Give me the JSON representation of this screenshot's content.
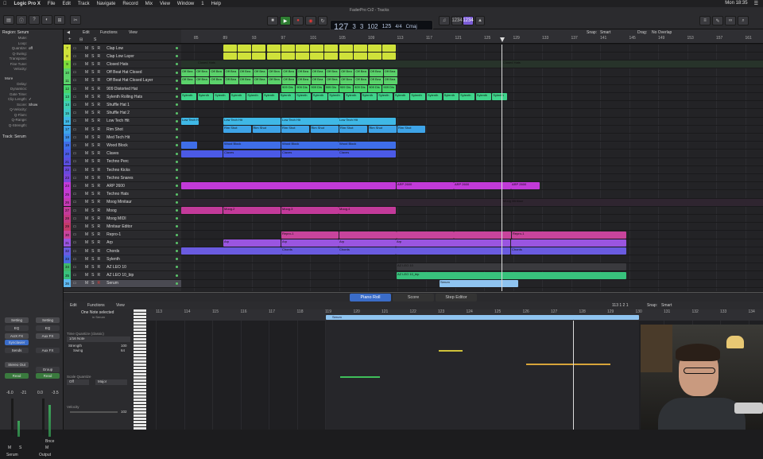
{
  "menubar": {
    "app": "Logic Pro X",
    "items": [
      "File",
      "Edit",
      "Track",
      "Navigate",
      "Record",
      "Mix",
      "View",
      "Window",
      "1",
      "Help"
    ],
    "time": "Mon 18:35"
  },
  "window_title": "FaderPro Cr2 - Tracks",
  "lcd": {
    "bar": "127",
    "beat": "3",
    "div": "3",
    "tick": "102",
    "tempo": "125",
    "timesig": "4/4",
    "key": "Cmaj",
    "bar_label": "BAR",
    "beat_label": "BEAT",
    "div_label": "DIV",
    "tick_label": "TICK",
    "tempo_label": "TEMPO",
    "sig_label": "KEY"
  },
  "toolbar": {
    "snap_label": "Snap:",
    "snap_value": "Smart",
    "drag_label": "Drag:",
    "drag_value": "No Overlap",
    "cpu_badge": "1234"
  },
  "inspector": {
    "region_label": "Region: Serum",
    "rows": [
      [
        "Mute:",
        ""
      ],
      [
        "Loop:",
        ""
      ],
      [
        "Quantize:",
        "off"
      ],
      [
        "Q-Swing:",
        ""
      ],
      [
        "Transpose:",
        ""
      ],
      [
        "Fine Tune:",
        ""
      ],
      [
        "Velocity:",
        ""
      ]
    ],
    "more": "More",
    "rows2": [
      [
        "Delay:",
        ""
      ],
      [
        "Dynamics:",
        ""
      ],
      [
        "Gate Time:",
        ""
      ],
      [
        "Clip Length:",
        "✓"
      ],
      [
        "Score:",
        "Show"
      ],
      [
        "Q-Velocity:",
        ""
      ],
      [
        "Q-Flam:",
        ""
      ],
      [
        "Q-Range:",
        ""
      ],
      [
        "Q-Strength:",
        ""
      ]
    ],
    "track_label": "Track: Serum",
    "strip1": {
      "setting": "Setting",
      "eq": "EQ",
      "fx": "AUX FX",
      "sidechain": "Synclavier",
      "sends": "Sends",
      "stereo": "Stereo Out",
      "mode": "Read",
      "vol": "-6.0",
      "pan": "-21",
      "name": "Serum"
    },
    "strip2": {
      "setting": "Setting",
      "eq": "EQ",
      "fx": "Aux FX",
      "sends": "Aux FX",
      "group": "Group",
      "mode": "Read",
      "vol": "0.0",
      "pan": "-3.5",
      "bnce": "Bnce",
      "name": "Output"
    }
  },
  "tracklist": {
    "edit": "Edit",
    "functions": "Functions",
    "view": "View",
    "tracks": [
      {
        "n": "7",
        "name": "Clap Low",
        "c": "#cfe13a"
      },
      {
        "n": "8",
        "name": "Clap Low Layer",
        "c": "#cfe13a"
      },
      {
        "n": "9",
        "name": "Closed Hats",
        "c": "#7ddc3a"
      },
      {
        "n": "10",
        "name": "Off Beat Hat Closed",
        "c": "#5bd26b"
      },
      {
        "n": "11",
        "name": "Off Beat Hat Closed Layer",
        "c": "#5bd26b"
      },
      {
        "n": "12",
        "name": "909 Distorted Hat",
        "c": "#48d46a"
      },
      {
        "n": "13",
        "name": "Sylenth Rolling Hats",
        "c": "#3fd48b"
      },
      {
        "n": "14",
        "name": "Shuffle Hat 1",
        "c": "#3fcfb1"
      },
      {
        "n": "15",
        "name": "Shuffle Hat 2",
        "c": "#3fc7c7"
      },
      {
        "n": "16",
        "name": "Low Tech Hit",
        "c": "#3fb8e6"
      },
      {
        "n": "17",
        "name": "Rim Shot",
        "c": "#3ea4e8"
      },
      {
        "n": "18",
        "name": "Med Tech Hit",
        "c": "#3c8fe8"
      },
      {
        "n": "19",
        "name": "Wood Block",
        "c": "#3f6ee8"
      },
      {
        "n": "20",
        "name": "Claves",
        "c": "#4b5ae6"
      },
      {
        "n": "21",
        "name": "Techno Perc",
        "c": "#5a4fe0"
      },
      {
        "n": "22",
        "name": "Techno Kicks",
        "c": "#6a49dc"
      },
      {
        "n": "23",
        "name": "Techno Snares",
        "c": "#7a45d8"
      },
      {
        "n": "24",
        "name": "ARP 2600",
        "c": "#c13ad8"
      },
      {
        "n": "25",
        "name": "Techno Hats",
        "c": "#c33ad0"
      },
      {
        "n": "26",
        "name": "Moog Minitaur",
        "c": "#c33ab4"
      },
      {
        "n": "27",
        "name": "Moog",
        "c": "#c33a9a"
      },
      {
        "n": "28",
        "name": "Moog MIDI",
        "c": "#c33a82"
      },
      {
        "n": "29",
        "name": "Minitaur Editor",
        "c": "#c33a6a"
      },
      {
        "n": "30",
        "name": "Repro-1",
        "c": "#c8449c"
      },
      {
        "n": "31",
        "name": "Arp",
        "c": "#9a55e0"
      },
      {
        "n": "32",
        "name": "Chords",
        "c": "#6a5be0"
      },
      {
        "n": "33",
        "name": "Sylenth",
        "c": "#4a68e0"
      },
      {
        "n": "34",
        "name": "AZ LEO 10",
        "c": "#3fb86a"
      },
      {
        "n": "35",
        "name": "AZ LEO 10_bip",
        "c": "#38c27c"
      },
      {
        "n": "36",
        "name": "Serum",
        "c": "#5fb8f0"
      }
    ]
  },
  "ruler": {
    "bars": [
      "85",
      "89",
      "93",
      "97",
      "101",
      "105",
      "109",
      "113",
      "117",
      "121",
      "125",
      "129",
      "133",
      "137",
      "141",
      "145",
      "149",
      "153",
      "157",
      "161"
    ]
  },
  "regions": [
    {
      "lane": 0,
      "labels": [
        "Clap Lo",
        "Clap Lo",
        "Clap Lo",
        "Clap Lo",
        "Clap Lo",
        "Clap Lo",
        "Clap Lo",
        "Clap Lo",
        "Clap Lo",
        "Clap Lo",
        "Clap Lo",
        "Clap Lo"
      ]
    },
    {
      "lane": 2,
      "left": "Closed Hats",
      "right": "Closed Hats"
    }
  ],
  "region_text": {
    "closed_hats": "Closed Hats",
    "off_beat": "Off Bea",
    "dist": "909 Dis",
    "sylenth": "Sylenth",
    "low_tech": "Low Tech Hit",
    "rim": "Rim Shot",
    "wood": "Wood Block",
    "claves": "Claves",
    "arp2600": "ARP 2600",
    "moog_minitaur": "Moog Minitaur",
    "moog2": "Moog.2",
    "moog3": "Moog.3",
    "moog4": "Moog.4",
    "repro": "Repro-1",
    "arp": "Arp",
    "chords": "Chords",
    "azleo": "AZ LEO 10",
    "azleobip": "AZ LEO 10_bip",
    "serum": "Serum"
  },
  "lower": {
    "tabs": [
      "Piano Roll",
      "Score",
      "Step Editor"
    ],
    "edit": "Edit",
    "functions": "Functions",
    "view": "View",
    "snap_label": "Snap:",
    "snap_value": "Smart",
    "pos": "113 1 2 1",
    "selected": "One Note selected",
    "selected_sub": "in Serum",
    "tq_label": "Time Quantize (classic)",
    "tq_value": "1/16 Note",
    "strength_label": "Strength",
    "strength_value": "100",
    "swing_label": "Swing",
    "swing_value": "64",
    "sq_label": "Scale Quantize",
    "sq_off": "Off",
    "sq_major": "Major",
    "vel_label": "Velocity",
    "vel_value": "102",
    "region": "Serum",
    "bars": [
      "113",
      "114",
      "115",
      "116",
      "117",
      "118",
      "119",
      "120",
      "121",
      "122",
      "123",
      "124",
      "125",
      "126",
      "127",
      "128",
      "129",
      "130",
      "131",
      "132",
      "133",
      "134"
    ]
  },
  "colors": {
    "accent": "#3a7bd5",
    "playhead": "#dddddd"
  }
}
